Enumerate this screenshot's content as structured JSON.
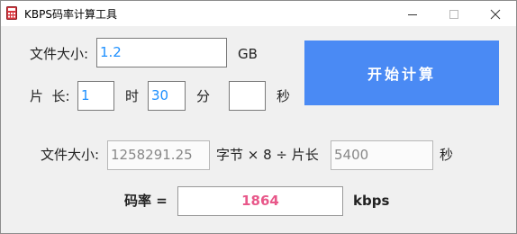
{
  "window": {
    "title": "KBPS码率计算工具",
    "icon": "calculator-icon",
    "controls": [
      "minimize-icon",
      "maximize-icon",
      "close-icon"
    ]
  },
  "inputs": {
    "file_size_label": "文件大小:",
    "file_size_value": "1.2",
    "file_size_unit": "GB",
    "duration_label": "片  长:",
    "hours_value": "1",
    "hours_unit": "时",
    "minutes_value": "30",
    "minutes_unit": "分",
    "seconds_value": "",
    "seconds_unit": "秒"
  },
  "calculate_button": "开始计算",
  "formula": {
    "file_size_label": "文件大小:",
    "bytes_value": "1258291.25",
    "operator_text": "字节 × 8 ÷ 片长",
    "duration_seconds": "5400",
    "seconds_unit": "秒"
  },
  "result": {
    "label": "码率 =",
    "value": "1864",
    "unit": "kbps"
  },
  "colors": {
    "accent_button": "#4a8af4",
    "input_text": "#1e90ff",
    "result_text": "#e8588a"
  }
}
